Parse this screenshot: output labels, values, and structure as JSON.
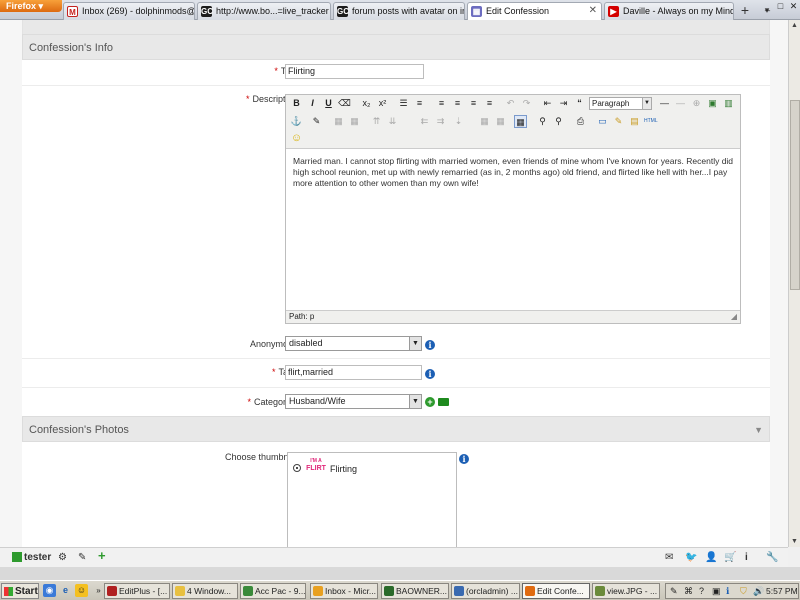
{
  "browser": {
    "menu_label": "Firefox",
    "tabs": [
      {
        "label": "Inbox (269) - dolphinmods@...",
        "icon": "gmail-icon",
        "color": "#c5221f",
        "glyph": "M"
      },
      {
        "label": "http://www.bo...=live_tracker",
        "icon": "site-logo-icon",
        "color": "#1d1d1d",
        "glyph": "GC"
      },
      {
        "label": "forum posts with avatar on in...",
        "icon": "site-logo-icon",
        "color": "#1d1d1d",
        "glyph": "GC"
      },
      {
        "label": "Edit Confession",
        "icon": "page-icon",
        "color": "#6c6cc0",
        "glyph": "▦",
        "active": true
      },
      {
        "label": "Daville - Always on my Mind -...",
        "icon": "youtube-icon",
        "color": "#d40000",
        "glyph": "▶"
      }
    ],
    "new_tab": "+",
    "all_tabs": "▾"
  },
  "form": {
    "section_info": "Confession's Info",
    "title_label": "Title:",
    "title_value": "Flirting",
    "description_label": "Description:",
    "editor_format": "Paragraph",
    "editor_text": "Married man. I cannot stop flirting with married women, even friends of mine whom I've known for years. Recently did high school reunion, met up with newly remarried (as in, 2 months ago) old friend, and flirted like hell with her...I pay more attention to other women than my own wife!",
    "editor_path": "Path: p",
    "anonymous_label": "Anonymous:",
    "anonymous_value": "disabled",
    "tags_label": "Tags:",
    "tags_value": "flirt,married",
    "categories_label": "Categories:",
    "categories_value": "Husband/Wife",
    "section_photos": "Confession's Photos",
    "thumbnail_label": "Choose thumbnail:",
    "thumbnail_option": "Flirting",
    "thumbnail_logo_top": "I'M A",
    "thumbnail_logo_bottom": "FLIRT",
    "required_mark": "*",
    "info_glyph": "i"
  },
  "bottombar": {
    "user": "tester"
  },
  "taskbar": {
    "start": "Start",
    "tasks": [
      {
        "label": "EditPlus - [...",
        "color": "#b02020"
      },
      {
        "label": "4 Window...",
        "color": "#e8c040"
      },
      {
        "label": "Acc Pac - 9...",
        "color": "#3a8a3a"
      },
      {
        "label": "Inbox - Micr...",
        "color": "#e8a020"
      },
      {
        "label": "BAOWNER...",
        "color": "#2a6a2a"
      },
      {
        "label": "(orcladmin) ...",
        "color": "#3a6ab0"
      },
      {
        "label": "Edit Confe...",
        "color": "#e06a10",
        "active": true
      },
      {
        "label": "view.JPG - ...",
        "color": "#6a8a3a"
      }
    ],
    "clock": "5:57 PM"
  },
  "colors": {
    "accent_blue": "#1c5fb4",
    "required_red": "#cc0000",
    "add_green": "#2e9a2e",
    "firefox_orange": "#e0781a"
  }
}
